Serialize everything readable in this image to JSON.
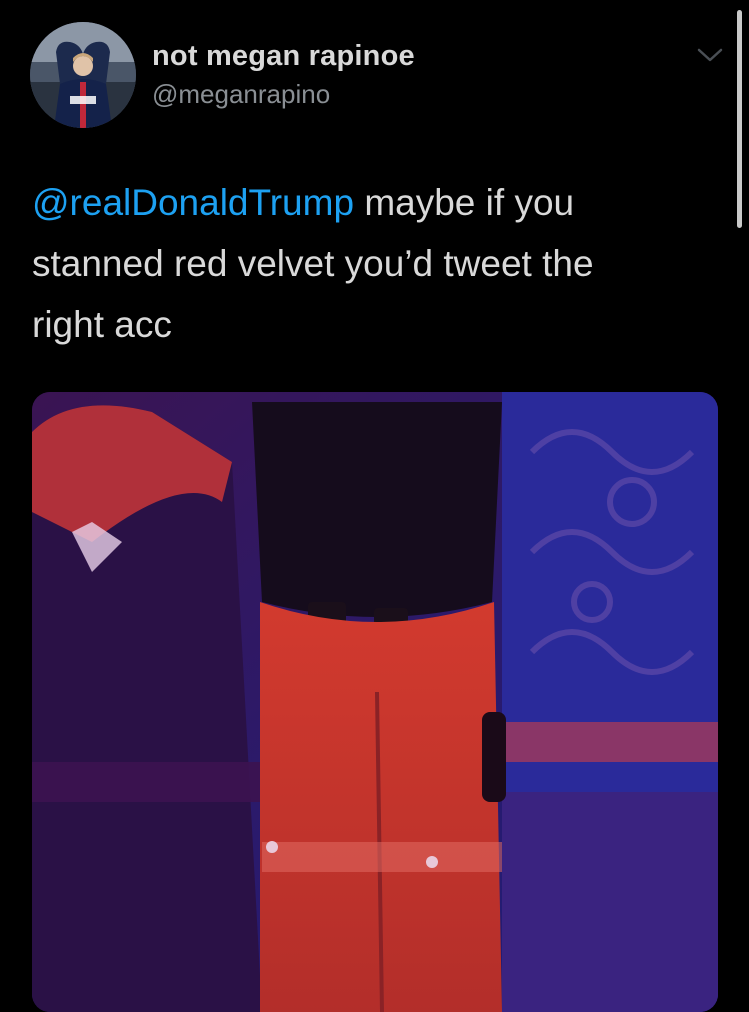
{
  "tweet": {
    "display_name": "not megan rapinoe",
    "handle": "@meganrapino",
    "mention": "@realDonaldTrump",
    "body_line1": " maybe if you",
    "body_line2": "stanned red velvet you’d tweet the",
    "body_line3": "right acc"
  },
  "icons": {
    "menu": "chevron-down-icon",
    "avatar": "profile-photo"
  },
  "colors": {
    "background": "#000000",
    "text": "#d9d9d9",
    "secondary_text": "#8a8f94",
    "accent": "#1da1f2"
  }
}
